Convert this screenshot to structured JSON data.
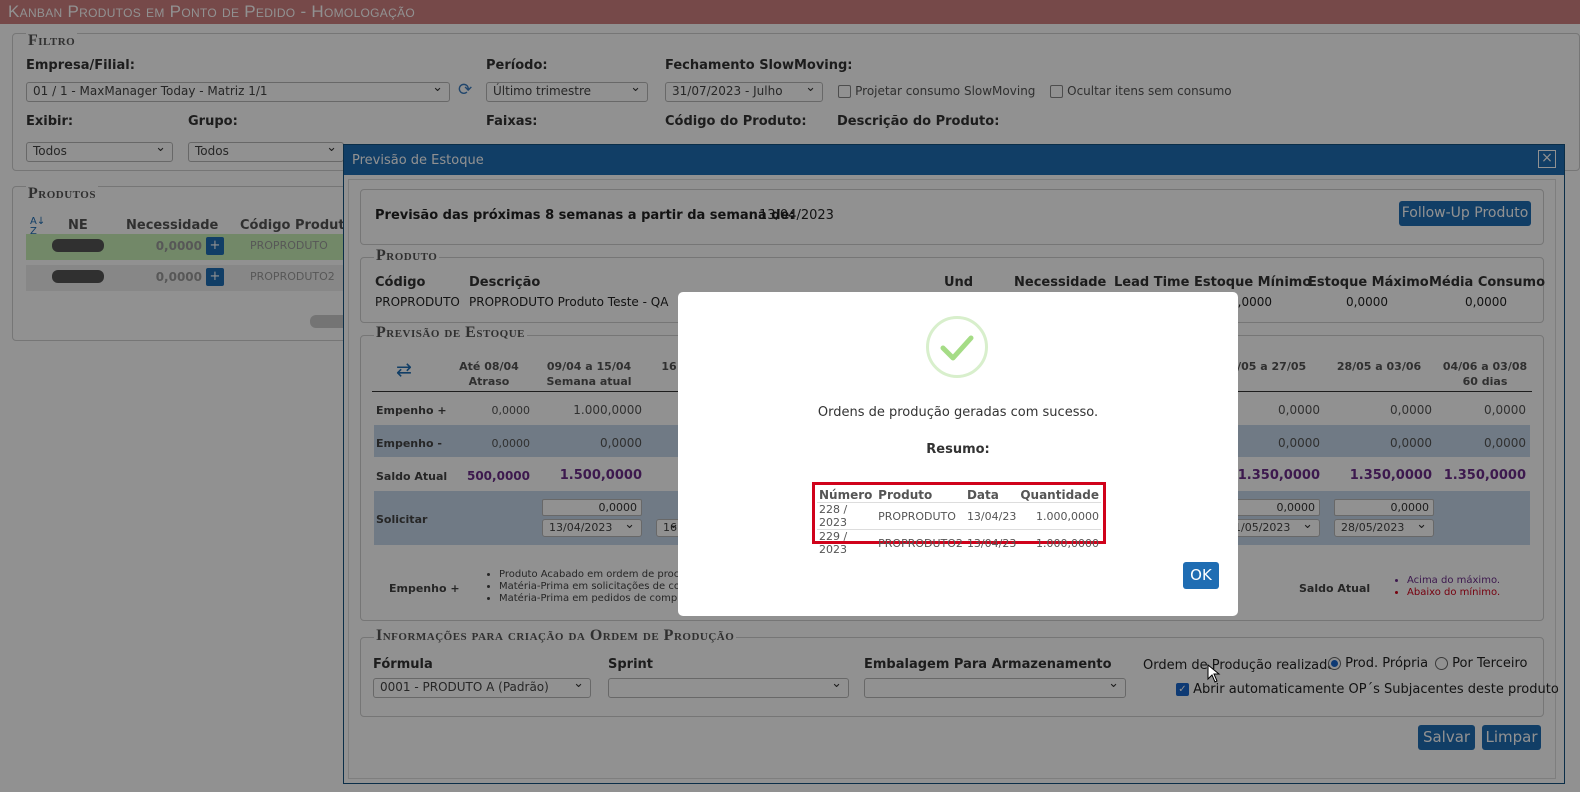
{
  "page_title": "Kanban Produtos em Ponto de Pedido  - Homologação",
  "filter": {
    "legend": "Filtro",
    "empresa_label": "Empresa/Filial:",
    "empresa_value": "01 / 1 - MaxManager Today - Matriz 1/1",
    "periodo_label": "Período:",
    "periodo_value": "Último trimestre",
    "fechamento_label": "Fechamento SlowMoving:",
    "fechamento_value": "31/07/2023 - Julho",
    "projetar_label": "Projetar consumo SlowMoving",
    "ocultar_label": "Ocultar itens sem consumo",
    "exibir_label": "Exibir:",
    "exibir_value": "Todos",
    "grupo_label": "Grupo:",
    "grupo_value": "Todos",
    "faixas_label": "Faixas:",
    "codigo_label": "Código do Produto:",
    "descricao_label": "Descrição do Produto:"
  },
  "produtos": {
    "legend": "Produtos",
    "col_ne": "NE",
    "col_necessidade": "Necessidade",
    "col_codigo": "Código Produto",
    "rows": [
      {
        "necessidade": "0,0000",
        "codigo": "PROPRODUTO"
      },
      {
        "necessidade": "0,0000",
        "codigo": "PROPRODUTO2"
      }
    ]
  },
  "modal": {
    "title": "Previsão de Estoque",
    "close": "×",
    "previsao_label": "Previsão das próximas 8 semanas a partir da semana de:",
    "previsao_date": "13/04/2023",
    "followup_button": "Follow-Up Produto",
    "produto_legend": "Produto",
    "produto_headers": [
      "Código",
      "Descrição",
      "Und",
      "Necessidade",
      "Lead Time",
      "Estoque Mínimo",
      "Estoque Máximo",
      "Média Consumo"
    ],
    "produto_codigo": "PROPRODUTO",
    "produto_descricao": "PROPRODUTO Produto Teste - QA",
    "produto_estoque_minimo": "0,0000",
    "produto_estoque_maximo": "0,0000",
    "produto_media_consumo": "0,0000",
    "previsao_legend": "Previsão de Estoque",
    "periods": [
      {
        "top": "Até 08/04",
        "bottom": "Atraso"
      },
      {
        "top": "09/04 a 15/04",
        "bottom": "Semana atual"
      },
      {
        "top": "16",
        "bottom": ""
      },
      {
        "top": "21/05 a 27/05",
        "bottom": ""
      },
      {
        "top": "28/05 a 03/06",
        "bottom": ""
      },
      {
        "top": "04/06 a 03/08",
        "bottom": "60 dias"
      }
    ],
    "row_empenho_plus": {
      "label": "Empenho +",
      "values": [
        "0,0000",
        "1.000,0000",
        "0,0000",
        "0,0000",
        "0,0000"
      ]
    },
    "row_empenho_minus": {
      "label": "Empenho -",
      "values": [
        "0,0000",
        "0,0000",
        "0,0000",
        "0,0000",
        "0,0000"
      ]
    },
    "row_saldo": {
      "label": "Saldo Atual",
      "values": [
        "500,0000",
        "1.500,0000",
        "1.350,0000",
        "1.350,0000",
        "1.350,0000"
      ]
    },
    "row_solicitar": {
      "label": "Solicitar",
      "qty": [
        "0,0000",
        "0,0000",
        "0,0000"
      ],
      "dates": [
        "13/04/2023",
        "16",
        "21/05/2023",
        "28/05/2023"
      ]
    },
    "legend_empenho": "Empenho +",
    "legend_items": [
      "Produto Acabado em ordem de proc",
      "Matéria-Prima em solicitações de co",
      "Matéria-Prima em pedidos de comp"
    ],
    "legend_saldo": "Saldo Atual",
    "legend_saldo_items": [
      "Acima do máximo.",
      "Abaixo do mínimo."
    ],
    "op_legend": "Informações para criação da Ordem de Produção",
    "formula_label": "Fórmula",
    "formula_value": "0001 - PRODUTO A (Padrão)",
    "sprint_label": "Sprint",
    "sprint_value": "",
    "embalagem_label": "Embalagem Para Armazenamento",
    "embalagem_value": "",
    "op_realizada_label": "Ordem de Produção realizada:",
    "prod_propria": "Prod. Própria",
    "por_terceiro": "Por Terceiro",
    "abrir_auto": "Abrir automaticamente OP´s Subjacentes deste produto",
    "salvar": "Salvar",
    "limpar": "Limpar"
  },
  "dialog": {
    "message": "Ordens de produção geradas com sucesso.",
    "resumo": "Resumo:",
    "headers": [
      "Número",
      "Produto",
      "Data",
      "Quantidade"
    ],
    "rows": [
      [
        "228 / 2023",
        "PROPRODUTO",
        "13/04/23",
        "1.000,0000"
      ],
      [
        "229 / 2023",
        "PROPRODUTO2",
        "13/04/23",
        "1.000,0000"
      ]
    ],
    "ok": "OK"
  },
  "colors": {
    "accent": "#1f6db3",
    "title_bar": "#d08080",
    "highlight_border": "#d0021b",
    "success": "#a5dc86"
  }
}
